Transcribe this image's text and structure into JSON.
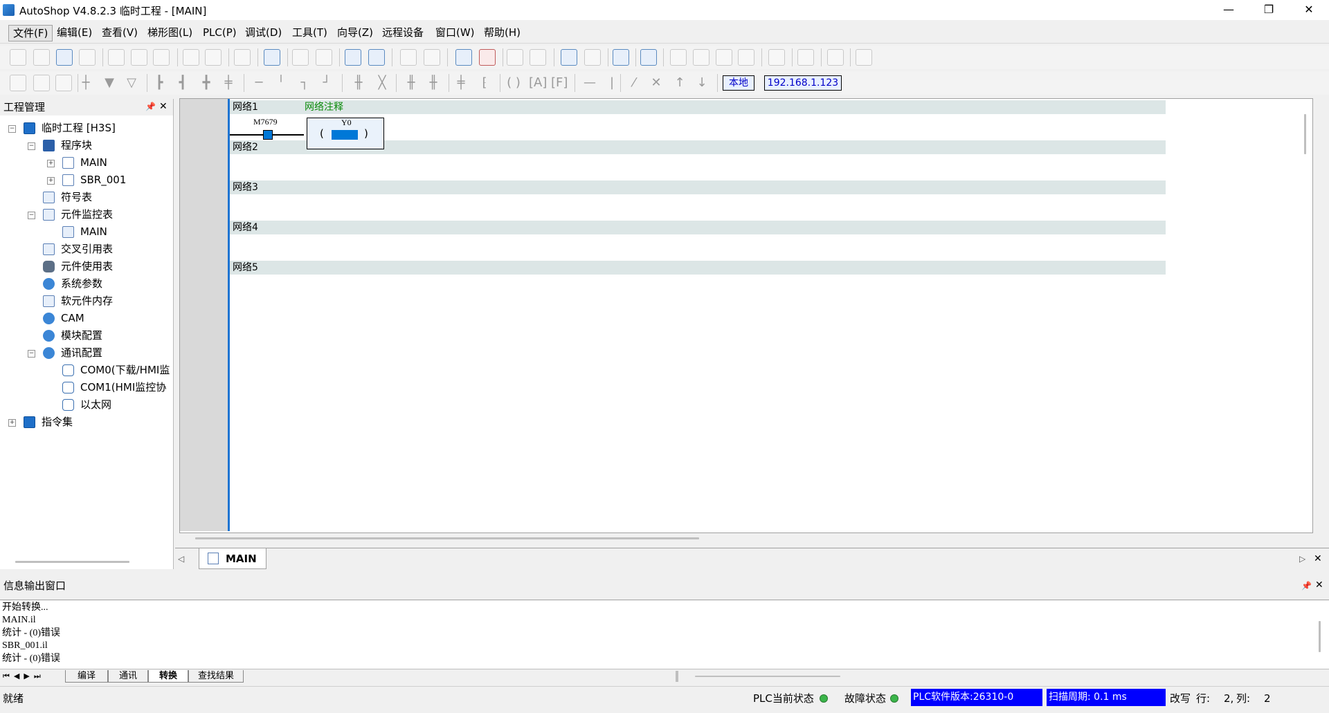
{
  "window": {
    "title": "AutoShop V4.8.2.3  临时工程 - [MAIN]",
    "minimize": "—",
    "restore": "❐",
    "close": "✕"
  },
  "menu": [
    "文件(F)",
    "编辑(E)",
    "查看(V)",
    "梯形图(L)",
    "PLC(P)",
    "调试(D)",
    "工具(T)",
    "向导(Z)",
    "远程设备",
    "窗口(W)",
    "帮助(H)"
  ],
  "toolbar2": {
    "local_label": "本地",
    "ip_address": "192.168.1.123"
  },
  "project_panel": {
    "title": "工程管理",
    "pin": "📌",
    "close": "✕",
    "tree": [
      {
        "label": "临时工程 [H3S]",
        "depth": 0,
        "expander": "−",
        "icon": "computer-icon"
      },
      {
        "label": "程序块",
        "depth": 1,
        "expander": "−",
        "icon": "program-blocks-icon"
      },
      {
        "label": "MAIN",
        "depth": 2,
        "expander": "+",
        "icon": "ladder-program-icon"
      },
      {
        "label": "SBR_001",
        "depth": 2,
        "expander": "+",
        "icon": "subroutine-icon"
      },
      {
        "label": "符号表",
        "depth": 1,
        "expander": "",
        "icon": "symbol-table-icon"
      },
      {
        "label": "元件监控表",
        "depth": 1,
        "expander": "−",
        "icon": "monitor-table-icon"
      },
      {
        "label": "MAIN",
        "depth": 2,
        "expander": "",
        "icon": "table-icon"
      },
      {
        "label": "交叉引用表",
        "depth": 1,
        "expander": "",
        "icon": "cross-reference-icon"
      },
      {
        "label": "元件使用表",
        "depth": 1,
        "expander": "",
        "icon": "database-icon"
      },
      {
        "label": "系统参数",
        "depth": 1,
        "expander": "",
        "icon": "system-params-icon"
      },
      {
        "label": "软元件内存",
        "depth": 1,
        "expander": "",
        "icon": "memory-icon"
      },
      {
        "label": "CAM",
        "depth": 1,
        "expander": "",
        "icon": "cam-icon"
      },
      {
        "label": "模块配置",
        "depth": 1,
        "expander": "",
        "icon": "module-config-icon"
      },
      {
        "label": "通讯配置",
        "depth": 1,
        "expander": "−",
        "icon": "comm-config-icon"
      },
      {
        "label": "COM0(下载/HMI监",
        "depth": 2,
        "expander": "",
        "icon": "serial-port-icon"
      },
      {
        "label": "COM1(HMI监控协",
        "depth": 2,
        "expander": "",
        "icon": "serial-port-icon"
      },
      {
        "label": "以太网",
        "depth": 2,
        "expander": "",
        "icon": "ethernet-icon"
      },
      {
        "label": "指令集",
        "depth": 0,
        "expander": "+",
        "icon": "instruction-set-icon"
      }
    ]
  },
  "editor": {
    "networks": [
      {
        "label": "网络1",
        "comment": "网络注释"
      },
      {
        "label": "网络2",
        "comment": ""
      },
      {
        "label": "网络3",
        "comment": ""
      },
      {
        "label": "网络4",
        "comment": ""
      },
      {
        "label": "网络5",
        "comment": ""
      }
    ],
    "rung1": {
      "contact": "M7679",
      "coil": "Y0",
      "coil_left": "(",
      "coil_right": ")"
    },
    "tab": "MAIN",
    "nav_left": "◁",
    "nav_right": "▷",
    "tab_close": "✕"
  },
  "output_panel": {
    "title": "信息输出窗口",
    "pin": "📌",
    "close": "✕",
    "lines": [
      "开始转换...",
      "MAIN.il",
      "统计 - (0)错误",
      "SBR_001.il",
      "统计 - (0)错误"
    ],
    "tabs": [
      "编译",
      "通讯",
      "转换",
      "查找结果"
    ],
    "active_tab": "转换"
  },
  "status": {
    "ready": "就绪",
    "plc_state_label": "PLC当前状态",
    "fault_state_label": "故障状态",
    "plc_version": "PLC软件版本:26310-0",
    "scan_cycle": "扫描周期: 0.1 ms",
    "mode": "改写",
    "row_label": "行:",
    "row_value": "2,",
    "col_label": "列:",
    "col_value": "2"
  }
}
